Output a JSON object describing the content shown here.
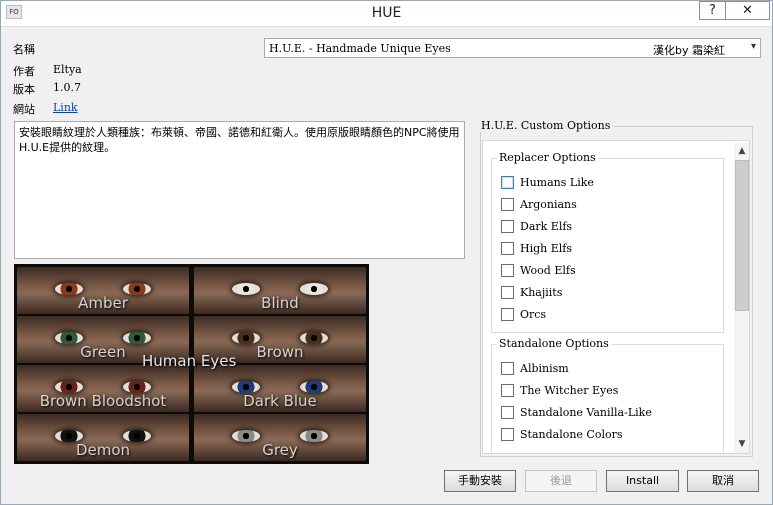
{
  "window": {
    "app_icon_text": "FO",
    "title": "HUE",
    "help_label": "?",
    "close_label": "✕"
  },
  "info": {
    "name_label": "名稱",
    "name_value": "",
    "author_label": "作者",
    "author_value": "Eltya",
    "version_label": "版本",
    "version_value": "1.0.7",
    "website_label": "網站",
    "website_value": "Link"
  },
  "selector": {
    "selected": "H.U.E. - Handmade Unique Eyes",
    "right_text": "漢化by 霜染紅",
    "arrow": "▾"
  },
  "description": "安裝眼睛紋理於人類種族：布萊頓、帝國、諾德和紅衛人。使用原版眼睛顏色的NPC將使用H.U.E提供的紋理。",
  "preview": {
    "overlay": "Human Eyes",
    "tiles": [
      {
        "label": "Amber",
        "iris": "#8a3a14"
      },
      {
        "label": "Blind",
        "iris": "#e9e4df"
      },
      {
        "label": "Green",
        "iris": "#2f5a3a"
      },
      {
        "label": "Brown",
        "iris": "#4a2e1c"
      },
      {
        "label": "Brown Bloodshot",
        "iris": "#6a2218"
      },
      {
        "label": "Dark Blue",
        "iris": "#1c3c7a"
      },
      {
        "label": "Demon",
        "iris": "#111111"
      },
      {
        "label": "Grey",
        "iris": "#8a8a86"
      }
    ]
  },
  "options": {
    "title": "H.U.E. Custom Options",
    "replacer_title": "Replacer Options",
    "replacer": [
      "Humans Like",
      "Argonians",
      "Dark Elfs",
      "High Elfs",
      "Wood Elfs",
      "Khajiits",
      "Orcs"
    ],
    "standalone_title": "Standalone Options",
    "standalone": [
      "Albinism",
      "The Witcher Eyes",
      "Standalone Vanilla-Like",
      "Standalone Colors"
    ],
    "scroll_up": "▲",
    "scroll_down": "▼"
  },
  "buttons": {
    "manual_install": "手動安裝",
    "back": "後退",
    "install": "Install",
    "cancel": "取消"
  }
}
